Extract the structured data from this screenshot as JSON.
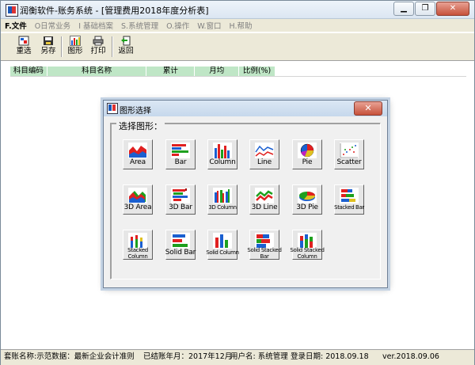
{
  "window": {
    "title": "润衡软件-账务系统 - [管理费用2018年度分析表]",
    "controls": {
      "minimize": "▁",
      "restore": "❐",
      "close": "✕"
    }
  },
  "menu": [
    {
      "label": "F.文件",
      "active": true
    },
    {
      "label": "O日常业务"
    },
    {
      "label": "I 基础档案"
    },
    {
      "label": "S.系统管理"
    },
    {
      "label": "O.操作"
    },
    {
      "label": "W.窗口"
    },
    {
      "label": "H.帮助"
    }
  ],
  "toolbar": {
    "reselect": "重选",
    "save_as": "另存",
    "chart": "图形",
    "print": "打印",
    "back": "返回"
  },
  "grid": {
    "headers": [
      "科目编码",
      "科目名称",
      "累计",
      "月均",
      "比例(%)"
    ]
  },
  "dialog": {
    "title": "图形选择",
    "close": "✕",
    "group_label": "选择图形：",
    "charts": [
      [
        "Area",
        "Bar",
        "Column",
        "Line",
        "Pie",
        "Scatter"
      ],
      [
        "3D Area",
        "3D Bar",
        "3D Column",
        "3D Line",
        "3D Pie",
        "Stacked Bar"
      ],
      [
        "Stacked Column",
        "Solid Bar",
        "Solid Column",
        "Solid Stacked Bar",
        "Solid Stacked Column"
      ]
    ]
  },
  "status": {
    "account_set": "套账名称:示范数据：最新企业会计准则",
    "closed_month": "已结账年月：2017年12月",
    "user": "用户名: 系统管理",
    "login_date": "登录日期: 2018.09.18",
    "version": "ver.2018.09.06"
  },
  "colors": {
    "accent_red": "#e02020",
    "accent_blue": "#1a5fd0",
    "accent_green": "#1ea01e",
    "header_bg": "#bfe6c6"
  },
  "icons": {
    "reselect": "reselect-icon",
    "save_as": "save-as-icon",
    "chart": "bar-chart-icon",
    "print": "printer-icon",
    "back": "back-icon"
  }
}
